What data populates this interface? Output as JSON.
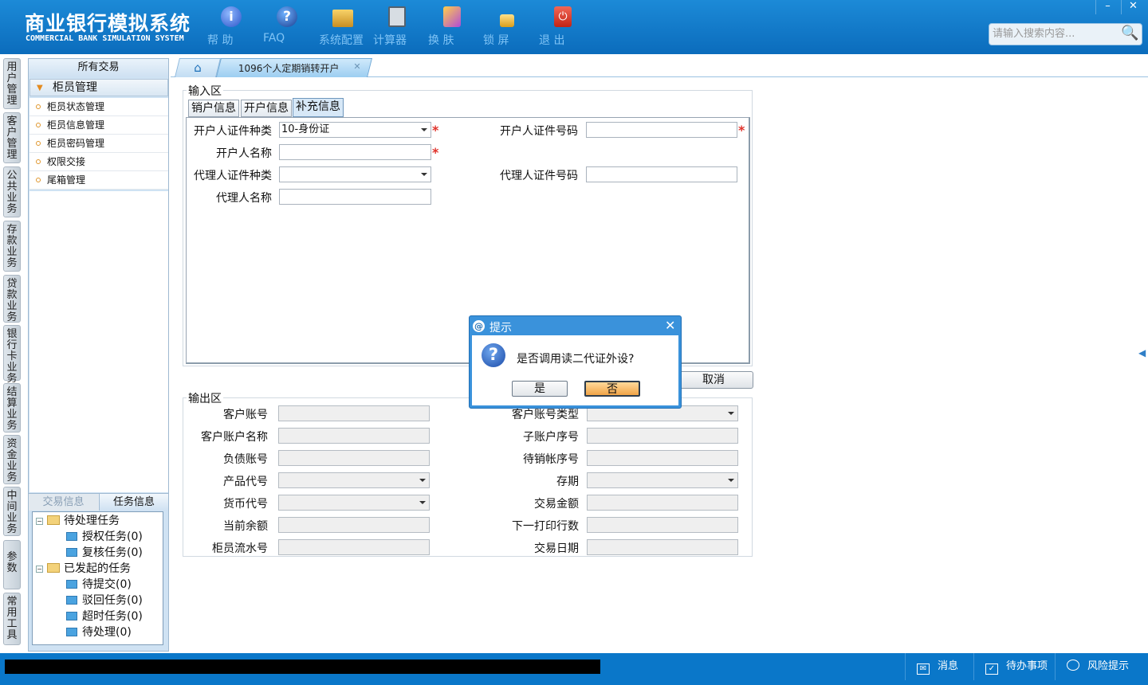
{
  "app": {
    "title_cn": "商业银行模拟系统",
    "title_en": "COMMERCIAL BANK SIMULATION SYSTEM"
  },
  "toolbar": [
    {
      "label": "帮 助",
      "icon": "info-icon"
    },
    {
      "label": "FAQ",
      "icon": "help-icon"
    },
    {
      "label": "系统配置",
      "icon": "toolbox-icon"
    },
    {
      "label": "计算器",
      "icon": "calculator-icon"
    },
    {
      "label": "换 肤",
      "icon": "skin-icon"
    },
    {
      "label": "锁 屏",
      "icon": "lock-icon"
    },
    {
      "label": "退 出",
      "icon": "power-icon"
    }
  ],
  "window": {
    "minimize": "–",
    "close": "✕"
  },
  "search": {
    "placeholder": "请输入搜索内容..."
  },
  "vtabs": [
    "用户管理",
    "客户管理",
    "公共业务",
    "存款业务",
    "贷款业务",
    "银行卡业务",
    "结算业务",
    "资金业务",
    "中间业务",
    "参数",
    "常用工具"
  ],
  "sidebar": {
    "all_label": "所有交易",
    "group": "柜员管理",
    "items": [
      "柜员状态管理",
      "柜员信息管理",
      "柜员密码管理",
      "权限交接",
      "尾箱管理"
    ],
    "lower_tabs": [
      "交易信息",
      "任务信息"
    ],
    "tree": {
      "pending": "待处理任务",
      "pending_children": [
        "授权任务(0)",
        "复核任务(0)"
      ],
      "initiated": "已发起的任务",
      "initiated_children": [
        "待提交(0)",
        "驳回任务(0)",
        "超时任务(0)",
        "待处理(0)"
      ]
    }
  },
  "tabs": {
    "home_icon": "⌂",
    "active": "1096个人定期销转开户",
    "close": "✕"
  },
  "input_area": {
    "legend": "输入区",
    "subtabs": [
      "销户信息",
      "开户信息",
      "补充信息"
    ],
    "fields": {
      "opener_id_type_label": "开户人证件种类",
      "opener_id_type_value": "10-身份证",
      "opener_id_no_label": "开户人证件号码",
      "opener_name_label": "开户人名称",
      "agent_id_type_label": "代理人证件种类",
      "agent_id_no_label": "代理人证件号码",
      "agent_name_label": "代理人名称"
    },
    "required_mark": "*",
    "cancel": "取消"
  },
  "output_area": {
    "legend": "输出区",
    "left_labels": [
      "客户账号",
      "客户账户名称",
      "负债账号",
      "产品代号",
      "货币代号",
      "当前余额",
      "柜员流水号"
    ],
    "right_labels": [
      "客户账号类型",
      "子账户序号",
      "待销帐序号",
      "存期",
      "交易金额",
      "下一打印行数",
      "交易日期"
    ]
  },
  "dialog": {
    "title": "提示",
    "message": "是否调用读二代证外设?",
    "yes": "是",
    "no": "否",
    "close": "✕",
    "question": "?"
  },
  "statusbar": {
    "items": [
      "消息",
      "待办事项",
      "风险提示"
    ]
  }
}
